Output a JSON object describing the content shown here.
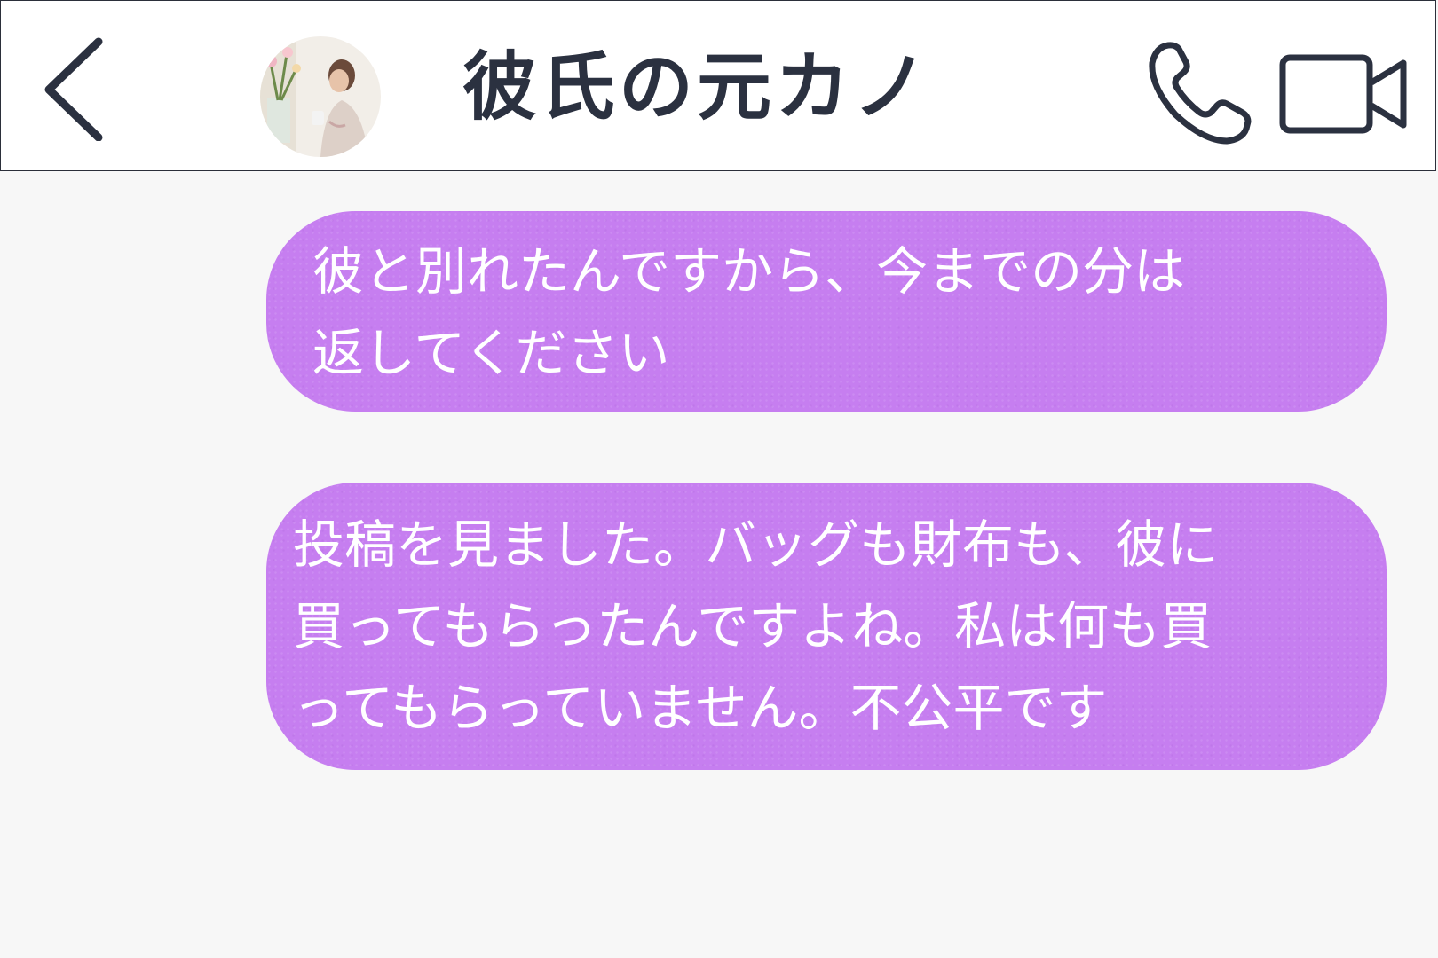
{
  "header": {
    "title": "彼氏の元カノ",
    "back_icon": "chevron-left-icon",
    "call_icon": "phone-icon",
    "video_icon": "video-camera-icon",
    "icon_color": "#2b3140"
  },
  "messages": [
    {
      "lines": [
        "彼と別れたんですから、今までの分は",
        "返してください"
      ]
    },
    {
      "lines": [
        "投稿を見ました。バッグも財布も、彼に",
        "買ってもらったんですよね。私は何も買",
        "ってもらっていません。不公平です"
      ]
    }
  ],
  "colors": {
    "bubble": "#c67ef0",
    "background": "#f7f7f7",
    "header_bg": "#ffffff"
  }
}
